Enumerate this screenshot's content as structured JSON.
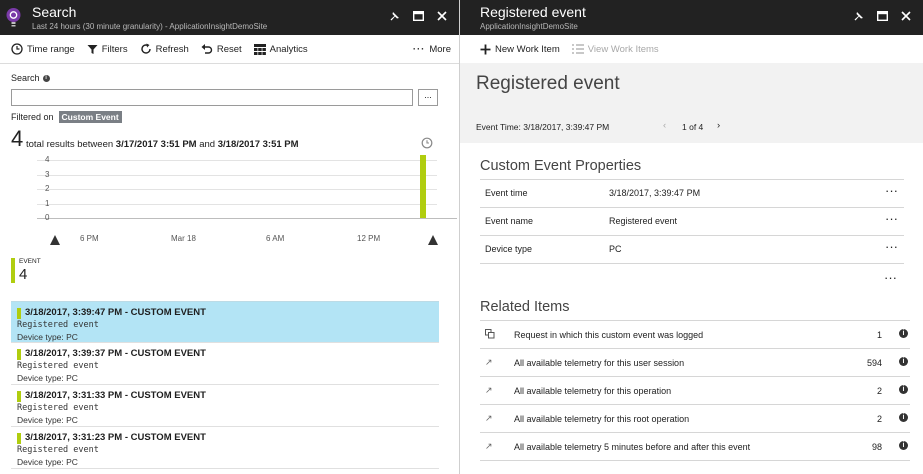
{
  "left": {
    "title": "Search",
    "subtitle": "Last 24 hours (30 minute granularity) - ApplicationInsightDemoSite",
    "toolbar": {
      "time_range": "Time range",
      "filters": "Filters",
      "refresh": "Refresh",
      "reset": "Reset",
      "analytics": "Analytics",
      "more": "More"
    },
    "search": {
      "label": "Search",
      "value": "",
      "placeholder": "",
      "more": "..."
    },
    "filter": {
      "prefix": "Filtered on",
      "tag": "Custom Event"
    },
    "summary": {
      "count": "4",
      "text_before": "total results between",
      "start": "3/17/2017 3:51 PM",
      "mid": "and",
      "end": "3/18/2017 3:51 PM"
    },
    "event_legend": {
      "label": "EVENT",
      "count": "4"
    },
    "results": [
      {
        "title": "3/18/2017, 3:39:47 PM - CUSTOM EVENT",
        "name": "Registered event",
        "device": "Device type: PC"
      },
      {
        "title": "3/18/2017, 3:39:37 PM - CUSTOM EVENT",
        "name": "Registered event",
        "device": "Device type: PC"
      },
      {
        "title": "3/18/2017, 3:31:33 PM - CUSTOM EVENT",
        "name": "Registered event",
        "device": "Device type: PC"
      },
      {
        "title": "3/18/2017, 3:31:23 PM - CUSTOM EVENT",
        "name": "Registered event",
        "device": "Device type: PC"
      }
    ]
  },
  "chart_data": {
    "type": "bar",
    "y_ticks": [
      "4",
      "3",
      "2",
      "1",
      "0"
    ],
    "x_ticks": [
      "6 PM",
      "Mar 18",
      "6 AM",
      "12 PM"
    ],
    "ylim": [
      0,
      4
    ],
    "series": [
      {
        "values": [
          4
        ]
      }
    ],
    "bar_color": "#b0cd0f"
  },
  "right": {
    "title": "Registered event",
    "subtitle": "ApplicationInsightDemoSite",
    "toolbar": {
      "new_work_item": "New Work Item",
      "view_work_items": "View Work Items"
    },
    "header": {
      "title": "Registered event",
      "event_time": "Event Time: 3/18/2017, 3:39:47 PM",
      "pager": "1 of 4"
    },
    "props_title": "Custom Event Properties",
    "props": [
      {
        "key": "Event time",
        "value": "3/18/2017, 3:39:47 PM"
      },
      {
        "key": "Event name",
        "value": "Registered event"
      },
      {
        "key": "Device type",
        "value": "PC"
      }
    ],
    "related_title": "Related Items",
    "related": [
      {
        "label": "Request in which this custom event was logged",
        "count": "1"
      },
      {
        "label": "All available telemetry for this user session",
        "count": "594"
      },
      {
        "label": "All available telemetry for this operation",
        "count": "2"
      },
      {
        "label": "All available telemetry for this root operation",
        "count": "2"
      },
      {
        "label": "All available telemetry 5 minutes before and after this event",
        "count": "98"
      }
    ]
  },
  "colors": {
    "accent": "#b0cd0f",
    "titlebar": "#222222",
    "selected_row": "#b3e4f5"
  }
}
